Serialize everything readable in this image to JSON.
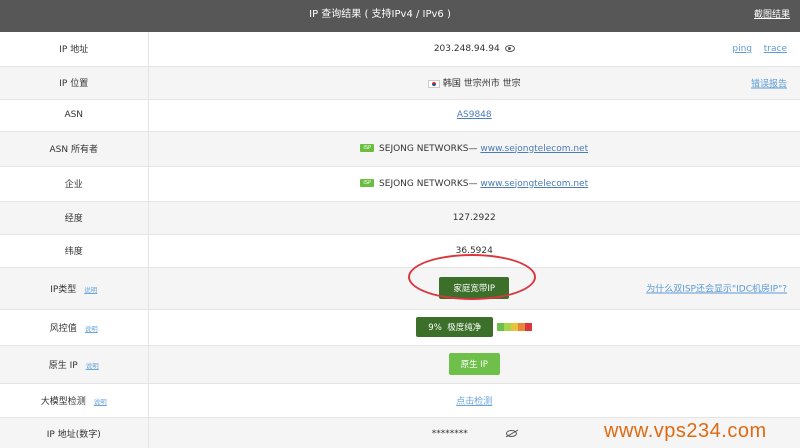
{
  "header": {
    "title": "IP 查询结果 ( 支持IPv4 / IPv6 )",
    "screenshot_link": "截图结果"
  },
  "rows": {
    "ip": {
      "label": "IP 地址",
      "value": "203.248.94.94",
      "ping": "ping",
      "trace": "trace"
    },
    "location": {
      "label": "IP 位置",
      "value": "韩国 世宗州市 世宗",
      "report": "错误报告"
    },
    "asn": {
      "label": "ASN",
      "value": "AS9848"
    },
    "asn_owner": {
      "label": "ASN 所有者",
      "tag": "ISP",
      "name": "SEJONG NETWORKS— ",
      "site": "www.sejongtelecom.net"
    },
    "company": {
      "label": "企业",
      "tag": "ISP",
      "name": "SEJONG NETWORKS— ",
      "site": "www.sejongtelecom.net"
    },
    "longitude": {
      "label": "经度",
      "value": "127.2922"
    },
    "latitude": {
      "label": "纬度",
      "value": "36.5924"
    },
    "ip_type": {
      "label": "IP类型",
      "help": "说明",
      "value": "家庭宽带IP",
      "why": "为什么双ISP还会显示\"IDC机房IP\"?"
    },
    "risk": {
      "label": "风控值",
      "help": "说明",
      "percent": "9%",
      "level": "极度纯净",
      "bar_colors": [
        "#6fc04a",
        "#a6d64a",
        "#e9c33c",
        "#e8883a",
        "#d9363e"
      ]
    },
    "native_ip": {
      "label": "原生 IP",
      "help": "说明",
      "value": "原生 IP"
    },
    "llm": {
      "label": "大模型检测",
      "help": "说明",
      "value": "点击检测"
    },
    "ip_number": {
      "label": "IP 地址(数字)",
      "value": "********"
    }
  },
  "watermark": "www.vps234.com"
}
